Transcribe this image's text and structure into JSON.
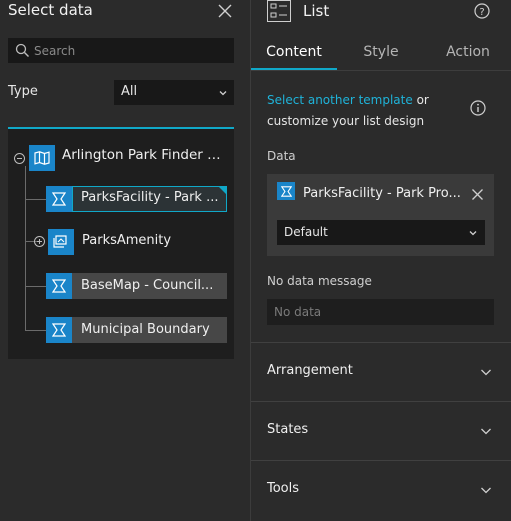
{
  "left_panel": {
    "title": "Select data",
    "search": {
      "placeholder": "Search",
      "value": ""
    },
    "type": {
      "label": "Type",
      "value": "All"
    },
    "tree": {
      "root": "Arlington Park Finder M...",
      "children": [
        {
          "label": "ParksFacility - Park ...",
          "selected": true
        },
        {
          "label": "ParksAmenity",
          "expandable": true
        },
        {
          "label": "BaseMap - Council..."
        },
        {
          "label": "Municipal Boundary"
        }
      ]
    }
  },
  "right_panel": {
    "title": "List",
    "tabs": [
      "Content",
      "Style",
      "Action"
    ],
    "active_tab": "Content",
    "template_link": "Select another template",
    "template_rest": " or customize your list design",
    "data_label": "Data",
    "data_source": "ParksFacility - Park Pro...",
    "view_value": "Default",
    "no_data_label": "No data message",
    "no_data_placeholder": "No data",
    "sections": [
      "Arrangement",
      "States",
      "Tools"
    ]
  },
  "colors": {
    "accent": "#10a8c8",
    "icon_bg": "#1a85c9",
    "link": "#1fb3d9"
  }
}
